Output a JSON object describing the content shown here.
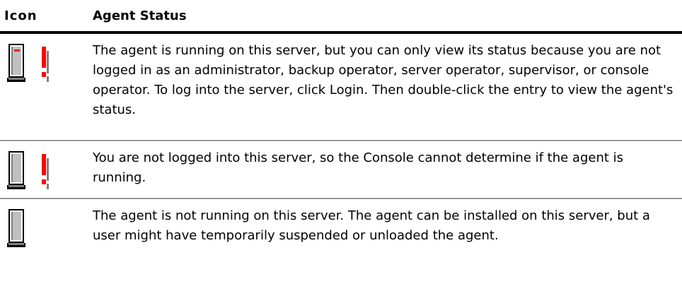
{
  "table": {
    "header": {
      "icon": "Icon",
      "status": "Agent Status"
    },
    "rows": [
      {
        "icon": "server-running-view-only-icon",
        "status": "The agent is running on this server, but you can only view its status because you are not logged in as an administrator, backup operator, server operator, supervisor, or console operator. To log into the server, click Login. Then double-click the entry to view the agent's status."
      },
      {
        "icon": "server-not-logged-in-icon",
        "status": "You are not logged into this server, so the Console cannot determine if the agent is running."
      },
      {
        "icon": "server-agent-not-running-icon",
        "status": "The agent is not running on this server. The agent can be installed on this server, but a user might have temporarily suspended or unloaded the agent."
      }
    ]
  },
  "colors": {
    "indicator_red": "#ff0000",
    "tower_gray": "#c0c0c0",
    "header_rule": "#000000",
    "row_rule": "#999999"
  }
}
